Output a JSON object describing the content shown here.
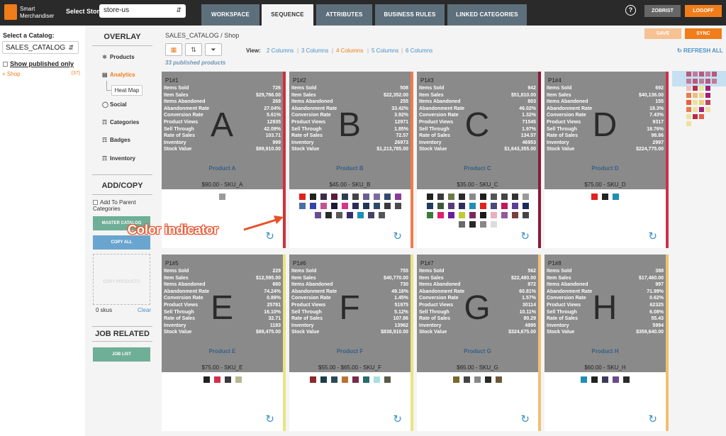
{
  "header": {
    "logo_text_1": "Smart",
    "logo_text_2": "Merchandiser",
    "store_label": "Select Store",
    "store_value": "store-us",
    "tabs": [
      "WORKSPACE",
      "SEQUENCE",
      "ATTRIBUTES",
      "BUSINESS RULES",
      "LINKED CATEGORIES"
    ],
    "active_tab": "SEQUENCE",
    "help": "?",
    "user": "ZOBRIST",
    "logoff": "LOGOFF"
  },
  "left": {
    "catalog_label": "Select a Catalog:",
    "catalog_value": "SALES_CATALOG",
    "show_published": "Show published only",
    "tree_item": "Shop",
    "tree_count": "(37)"
  },
  "overlay": {
    "title": "OVERLAY",
    "products": "Products",
    "analytics": "Analytics",
    "heatmap": "Heat Map",
    "social": "Social",
    "categories": "Categories",
    "badges": "Badges",
    "inventory": "Inventory"
  },
  "addcopy": {
    "title": "ADD/COPY",
    "add_parent": "Add To Parent Categories",
    "master_catalog": "MASTER CATALOG",
    "copy_all": "COPY ALL",
    "dropzone": "COPY PRODUCTS",
    "skus": "0 skus",
    "clear": "Clear"
  },
  "job": {
    "title": "JOB RELATED",
    "job_list": "JOB LIST"
  },
  "toolbar": {
    "breadcrumb": "SALES_CATALOG  /  Shop",
    "view_label": "View:",
    "columns": [
      "2 Columns",
      "3 Columns",
      "4 Columns",
      "5 Columns",
      "6 Columns"
    ],
    "active_columns": "4 Columns",
    "published": "33 published products",
    "save": "SAVE",
    "sync": "SYNC",
    "refresh": "REFRESH ALL"
  },
  "annotation": "Color indicator",
  "stat_labels": [
    "Items Sold",
    "Item Sales",
    "Items Abandoned",
    "Abandonment Rate",
    "Conversion Rate",
    "Product Views",
    "Sell Through",
    "Rate of Sales",
    "Inventory",
    "Stock Value"
  ],
  "products": [
    {
      "pos": "P1#1",
      "letter": "A",
      "name": "Product A",
      "price": "$90.00 - SKU_A",
      "bar": "#d0303a",
      "stats": [
        "726",
        "$29,766.00",
        "269",
        "27.04%",
        "5.61%",
        "12935",
        "42.09%",
        "103.71",
        "999",
        "$89,910.00"
      ],
      "swatches": [
        "#9a9a9a"
      ]
    },
    {
      "pos": "P1#2",
      "letter": "B",
      "name": "Product B",
      "price": "$45.00 - SKU_B",
      "bar": "#f07d4a",
      "stats": [
        "508",
        "$22,352.00",
        "255",
        "33.42%",
        "3.92%",
        "12971",
        "1.85%",
        "72.57",
        "26973",
        "$1,213,785.00"
      ],
      "swatches": [
        "#e0211f",
        "#222222",
        "#3c2d4a",
        "#5a1c3a",
        "#2c3e50",
        "#444444",
        "#6b5b95",
        "#7a6ba0",
        "#33496e",
        "#8a3a9a",
        "#4a6fa5",
        "#3344aa",
        "#c1529a",
        "#1a1a3a",
        "#d6338a",
        "#2b2b5a",
        "#1d3557",
        "#2e4a62",
        "#3a3a3a",
        "#4a4a4a",
        "#6a4c93",
        "#2a2a2a",
        "#5a5a5a",
        "#3a2a6a",
        "#1f8fb3",
        "#444466",
        "#555555"
      ]
    },
    {
      "pos": "P1#3",
      "letter": "C",
      "name": "Product C",
      "price": "$35.00 - SKU_C",
      "bar": "#8b1a3a",
      "stats": [
        "942",
        "$51,810.00",
        "803",
        "46.02%",
        "1.32%",
        "71545",
        "1.97%",
        "134.57",
        "46953",
        "$1,643,355.00"
      ],
      "swatches": [
        "#222222",
        "#3a3a3a",
        "#6a7a4a",
        "#2a2a2a",
        "#8a8a8a",
        "#1e1e1e",
        "#555555",
        "#444444",
        "#333333",
        "#9a9a9a",
        "#1d3d5c",
        "#3a5a3a",
        "#5a3a7a",
        "#2e2e5a",
        "#1f8fb3",
        "#e0211f",
        "#4a4a7a",
        "#c2185b",
        "#5b3e96",
        "#1a2a5a",
        "#3a7a3a",
        "#e0216b",
        "#6a1b9a",
        "#c0ca33",
        "#7a2a5a",
        "#1a1a1a",
        "#e6b0c0",
        "#8e5a9a",
        "#7a3e3e",
        "#444444",
        "#6a6a6a",
        "#2a2a2a",
        "#888888",
        "#dddddd"
      ]
    },
    {
      "pos": "P1#4",
      "letter": "D",
      "name": "Product D",
      "price": "$75.00 - SKU_D",
      "bar": "#d0304a",
      "stats": [
        "692",
        "$40,136.00",
        "155",
        "18.3%",
        "7.43%",
        "9317",
        "18.76%",
        "98.86",
        "2997",
        "$224,775.00"
      ],
      "swatches": [
        "#e0211f",
        "#222222",
        "#1f8fb3"
      ]
    },
    {
      "pos": "P1#5",
      "letter": "E",
      "name": "Product E",
      "price": "$75.00 - SKU_E",
      "bar": "#e6e680",
      "stats": [
        "229",
        "$12,595.00",
        "660",
        "74.24%",
        "0.89%",
        "25781",
        "16.10%",
        "32.71",
        "1193",
        "$89,475.00"
      ],
      "swatches": [
        "#222222",
        "#d0304a",
        "#3a3a3a",
        "#b8b890"
      ]
    },
    {
      "pos": "P1#6",
      "letter": "F",
      "name": "Product F",
      "price": "$55.00 - $65.00 - SKU_F",
      "bar": "#e6e680",
      "stats": [
        "755",
        "$40,770.00",
        "730",
        "49.16%",
        "1.45%",
        "51975",
        "5.12%",
        "107.86",
        "13962",
        "$838,910.00"
      ],
      "swatches": [
        "#8b2a2a",
        "#1d3d4c",
        "#2a4a5a",
        "#b87333",
        "#7a2a4a",
        "#2a6a6a",
        "#a8e0e0",
        "#5a5a4a"
      ]
    },
    {
      "pos": "P1#7",
      "letter": "G",
      "name": "Product G",
      "price": "$65.00 - SKU_G",
      "bar": "#f0c070",
      "stats": [
        "562",
        "$22,480.00",
        "872",
        "60.81%",
        "1.57%",
        "30114",
        "10.11%",
        "80.29",
        "4995",
        "$324,675.00"
      ],
      "swatches": [
        "#7a6a2a",
        "#444444",
        "#888888",
        "#2a2a2a",
        "#6a5a3a"
      ]
    },
    {
      "pos": "P1#8",
      "letter": "H",
      "name": "Product H",
      "price": "$60.00 - SKU_H",
      "bar": "#f0c070",
      "stats": [
        "388",
        "$17,460.00",
        "997",
        "71.99%",
        "0.62%",
        "62325",
        "6.08%",
        "55.43",
        "5994",
        "$359,640.00"
      ],
      "swatches": [
        "#1f8fb3",
        "#222222",
        "#3a3a5a",
        "#6a4a8a",
        "#2a2a2a"
      ]
    }
  ]
}
